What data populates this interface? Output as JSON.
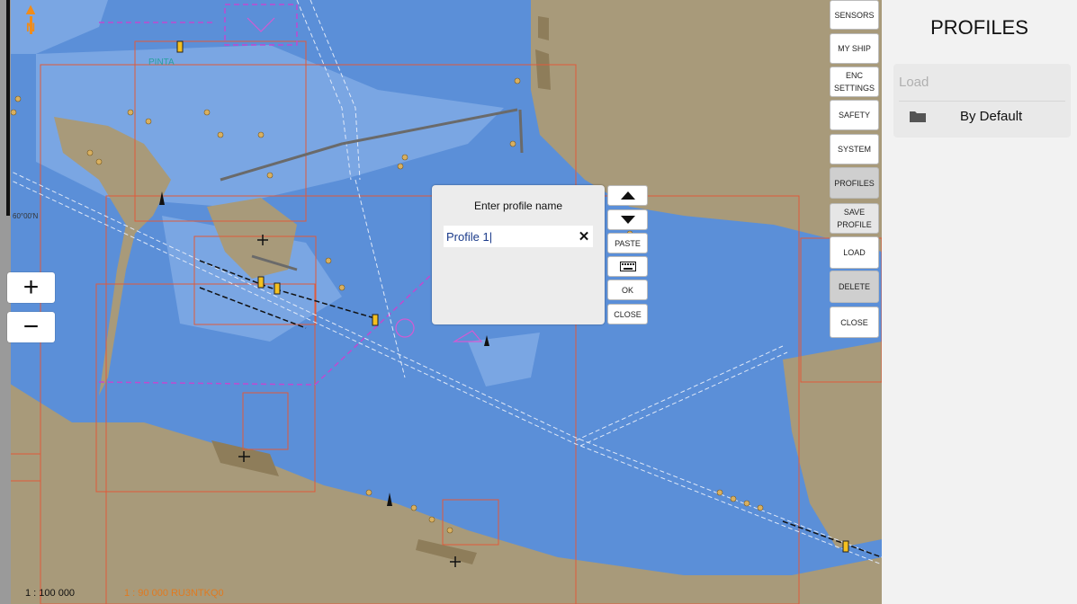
{
  "map": {
    "scale_primary": "1 : 100 000",
    "scale_secondary": "1 : 90 000  RU3NTKQ0",
    "lat_label": "60°00'N",
    "north_label": "N",
    "zoom_in_label": "+",
    "zoom_out_label": "−"
  },
  "menu": {
    "sensors": "SENSORS",
    "my_ship": "MY SHIP",
    "enc_settings": "ENC SETTINGS",
    "safety": "SAFETY",
    "system": "SYSTEM",
    "profiles": "PROFILES",
    "save_profile": "SAVE PROFILE",
    "load": "LOAD",
    "delete": "DELETE",
    "close": "CLOSE"
  },
  "panel": {
    "title": "PROFILES",
    "list_placeholder": "Load",
    "items": [
      "By Default"
    ]
  },
  "dialog": {
    "title": "Enter profile name",
    "input_value": "Profile 1|",
    "clear_label": "✕",
    "paste": "PASTE",
    "ok": "OK",
    "close": "CLOSE"
  },
  "colors": {
    "deep_water": "#5b8fd8",
    "shallow_water": "#7aa6e3",
    "land": "#a89a7a",
    "accent_orange": "#f08c1a"
  }
}
